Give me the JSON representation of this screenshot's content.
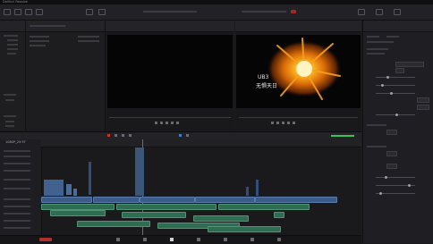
{
  "app": {
    "title": "DaVinci Resolve"
  },
  "toolbar": {
    "icons": [
      "media-pool-icon",
      "effects-icon",
      "edit-index-icon",
      "sound-library-icon",
      "mixer-icon",
      "metadata-icon",
      "inspector-icon"
    ]
  },
  "program_viewer": {
    "overlay_line1": "UB3",
    "overlay_line2": "无惧天日"
  },
  "timeline": {
    "name": "1080P_29.97"
  },
  "accent": {
    "clip_video": "#3c5b86",
    "clip_audio": "#2f6d52",
    "record": "#c0392b",
    "audio_meter": "#39c35a"
  }
}
